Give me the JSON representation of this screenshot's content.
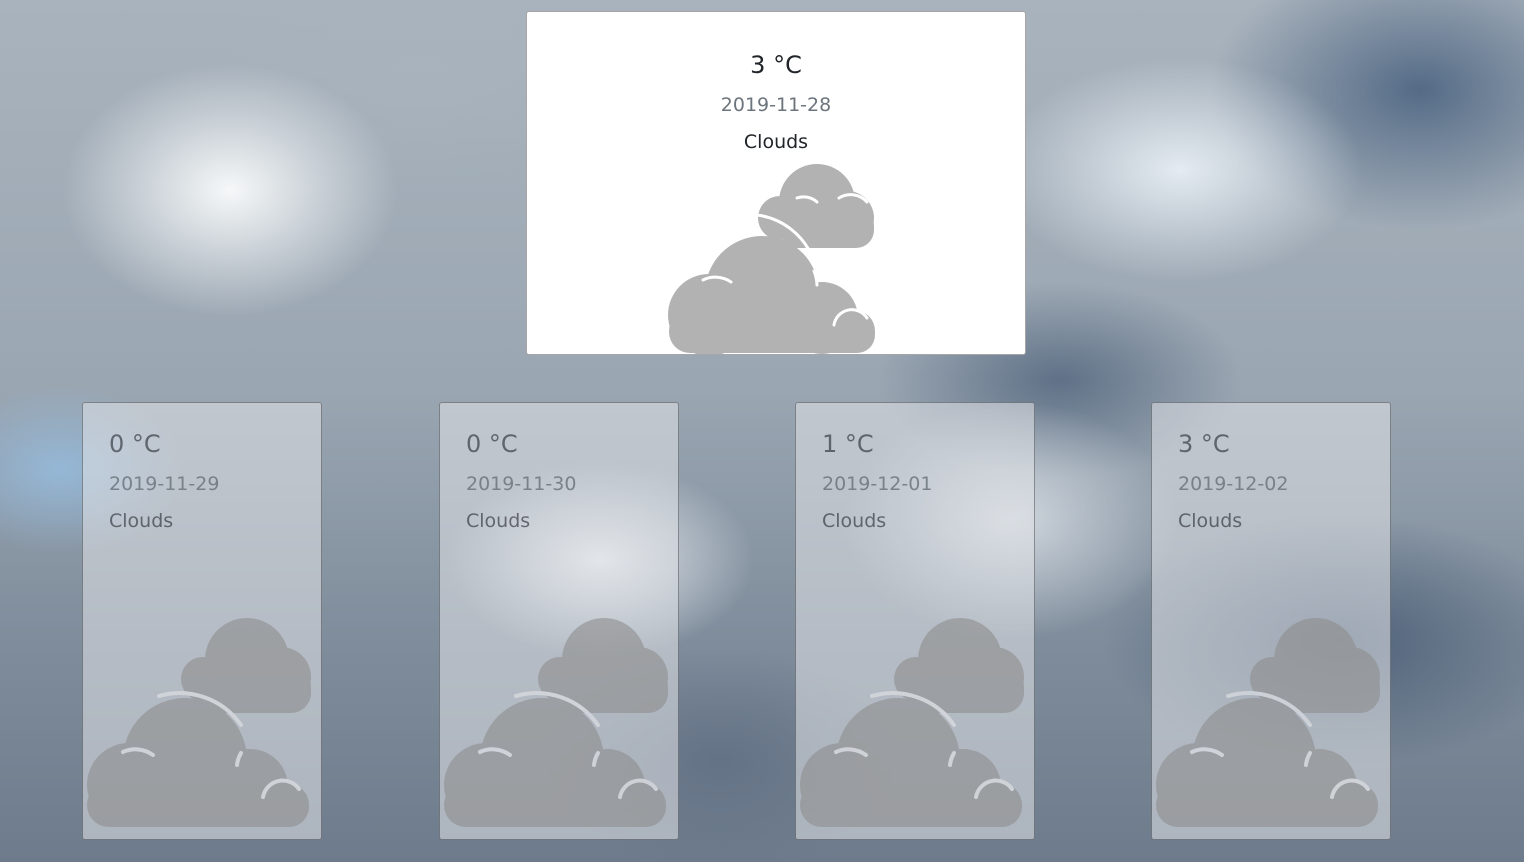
{
  "current": {
    "temperature": "3 °C",
    "date": "2019-11-28",
    "condition": "Clouds",
    "icon": "clouds-icon"
  },
  "forecast": [
    {
      "temperature": "0 °C",
      "date": "2019-11-29",
      "condition": "Clouds",
      "icon": "clouds-icon"
    },
    {
      "temperature": "0 °C",
      "date": "2019-11-30",
      "condition": "Clouds",
      "icon": "clouds-icon"
    },
    {
      "temperature": "1 °C",
      "date": "2019-12-01",
      "condition": "Clouds",
      "icon": "clouds-icon"
    },
    {
      "temperature": "3 °C",
      "date": "2019-12-02",
      "condition": "Clouds",
      "icon": "clouds-icon"
    }
  ],
  "colors": {
    "icon_gray": "#b2b2b2",
    "text_dark": "#212529",
    "text_muted": "#6c757d"
  }
}
